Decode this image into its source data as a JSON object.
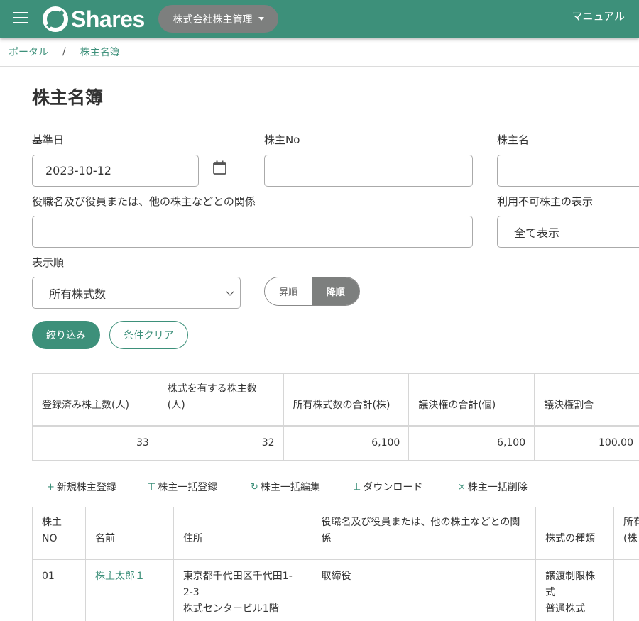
{
  "header": {
    "logo_text": "Shares",
    "company": "株式会社株主管理",
    "manual": "マニュアル"
  },
  "breadcrumb": {
    "items": [
      "ポータル",
      "株主名簿"
    ],
    "separator": "/"
  },
  "page": {
    "title": "株主名簿"
  },
  "filters": {
    "base_date_label": "基準日",
    "base_date_value": "2023-10-12",
    "shareholder_no_label": "株主No",
    "shareholder_no_value": "",
    "shareholder_name_label": "株主名",
    "shareholder_name_value": "",
    "relation_label": "役職名及び役員または、他の株主などとの関係",
    "relation_value": "",
    "unavailable_label": "利用不可株主の表示",
    "unavailable_value": "全て表示",
    "order_label": "表示順",
    "order_value": "所有株式数",
    "asc": "昇順",
    "desc": "降順",
    "selected_direction": "desc",
    "filter_button": "絞り込み",
    "clear_button": "条件クリア"
  },
  "summary": {
    "headers": [
      "登録済み株主数(人)",
      "株式を有する株主数(人)",
      "所有株式数の合計(株)",
      "議決権の合計(個)",
      "議決権割合"
    ],
    "values": [
      "33",
      "32",
      "6,100",
      "6,100",
      "100.00"
    ]
  },
  "actions": [
    {
      "icon": "+",
      "icon_name": "plus-icon",
      "label": "新規株主登録"
    },
    {
      "icon": "⊤",
      "icon_name": "upload-icon",
      "label": "株主一括登録"
    },
    {
      "icon": "↻",
      "icon_name": "refresh-icon",
      "label": "株主一括編集"
    },
    {
      "icon": "⊥",
      "icon_name": "download-icon",
      "label": "ダウンロード"
    },
    {
      "icon": "×",
      "icon_name": "close-icon",
      "label": "株主一括削除"
    }
  ],
  "list": {
    "headers": [
      "株主NO",
      "名前",
      "住所",
      "役職名及び役員または、他の株主などとの関係",
      "株式の種類",
      "所有(株"
    ],
    "rows": [
      {
        "no": "01",
        "name": "株主太郎１",
        "address_lines": [
          "東京都千代田区千代田1-2-3",
          "株式センタービル1階"
        ],
        "relation": "取締役",
        "share_types": [
          "譲渡制限株式",
          "普通株式"
        ],
        "shares": ""
      }
    ]
  },
  "colors": {
    "brand": "#3d907a",
    "pill_gray": "#7d7f7e"
  }
}
